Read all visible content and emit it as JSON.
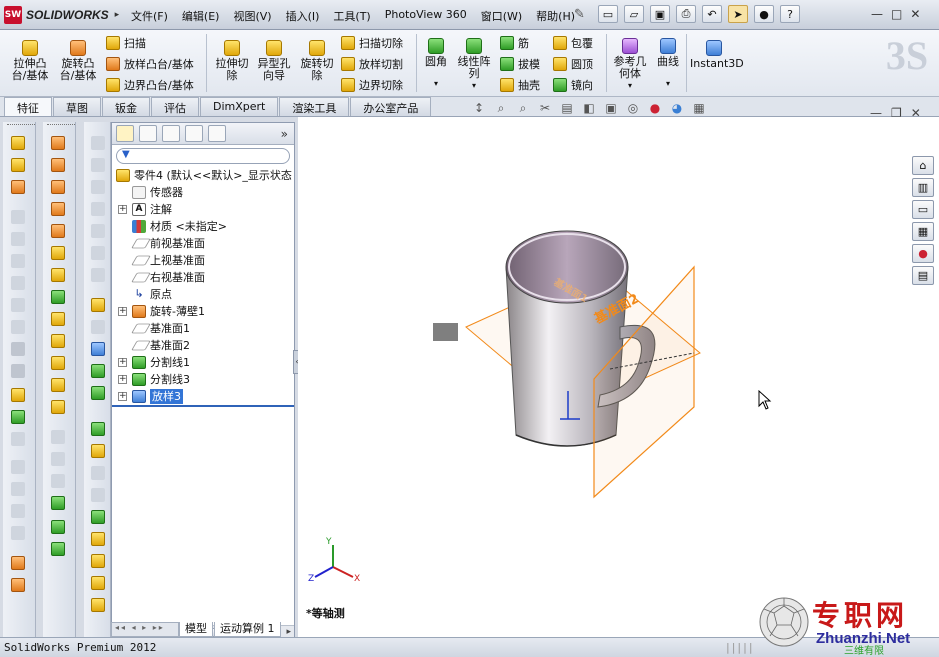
{
  "app": {
    "brand": "SOLIDWORKS",
    "logo_badge": "SW",
    "status_text": "SolidWorks Premium 2012"
  },
  "menu": {
    "items": [
      "文件(F)",
      "编辑(E)",
      "视图(V)",
      "插入(I)",
      "工具(T)",
      "PhotoView 360",
      "窗口(W)",
      "帮助(H)"
    ]
  },
  "ribbon": {
    "extrude_boss": "拉伸凸\n台/基体",
    "revolve_boss": "旋转凸\n台/基体",
    "sweep": "扫描",
    "loft_boss": "放样凸台/基体",
    "boundary_boss": "边界凸台/基体",
    "extrude_cut": "拉伸切\n除",
    "hole_wizard": "异型孔\n向导",
    "revolve_cut": "旋转切\n除",
    "swept_cut": "扫描切除",
    "lofted_cut": "放样切割",
    "boundary_cut": "边界切除",
    "fillet": "圆角",
    "linear_pattern": "线性阵\n列",
    "rib": "筋",
    "draft": "拔模",
    "shell": "抽壳",
    "wrap": "包覆",
    "dome": "圆顶",
    "mirror": "镜向",
    "ref_geometry": "参考几\n何体",
    "curves": "曲线",
    "instant3d": "Instant3D"
  },
  "tabs": [
    "特征",
    "草图",
    "钣金",
    "评估",
    "DimXpert",
    "渲染工具",
    "办公室产品"
  ],
  "active_tab": "特征",
  "feature_tree": {
    "root": "零件4  (默认<<默认>_显示状态",
    "items": [
      {
        "label": "传感器",
        "icon": "sensor-icon",
        "expand": false
      },
      {
        "label": "注解",
        "icon": "annotation-icon",
        "expand": true
      },
      {
        "label": "材质 <未指定>",
        "icon": "material-icon",
        "expand": false
      },
      {
        "label": "前视基准面",
        "icon": "plane-icon",
        "expand": false
      },
      {
        "label": "上视基准面",
        "icon": "plane-icon",
        "expand": false
      },
      {
        "label": "右视基准面",
        "icon": "plane-icon",
        "expand": false
      },
      {
        "label": "原点",
        "icon": "origin-icon",
        "expand": false
      },
      {
        "label": "旋转-薄壁1",
        "icon": "revolve-icon",
        "expand": true
      },
      {
        "label": "基准面1",
        "icon": "plane-icon",
        "expand": false
      },
      {
        "label": "基准面2",
        "icon": "plane-icon",
        "expand": false
      },
      {
        "label": "分割线1",
        "icon": "split-line-icon",
        "expand": true
      },
      {
        "label": "分割线3",
        "icon": "split-line-icon",
        "expand": true
      },
      {
        "label": "放样3",
        "icon": "loft-icon",
        "expand": true,
        "selected": true
      }
    ]
  },
  "bottom_tabs": [
    "模型",
    "运动算例 1"
  ],
  "viewport": {
    "view_label": "*等轴测",
    "plane_label": "基准面2",
    "plane_label_back": "基准面1",
    "triad": {
      "x": "X",
      "y": "Y",
      "z": "Z"
    }
  },
  "watermark": {
    "title": "专职网",
    "url": "Zhuanzhi.Net",
    "sub": "三维有限"
  },
  "colors": {
    "selection": "#3375d6",
    "plane_orange": "#f28a1a",
    "brand_red": "#c8102e"
  }
}
